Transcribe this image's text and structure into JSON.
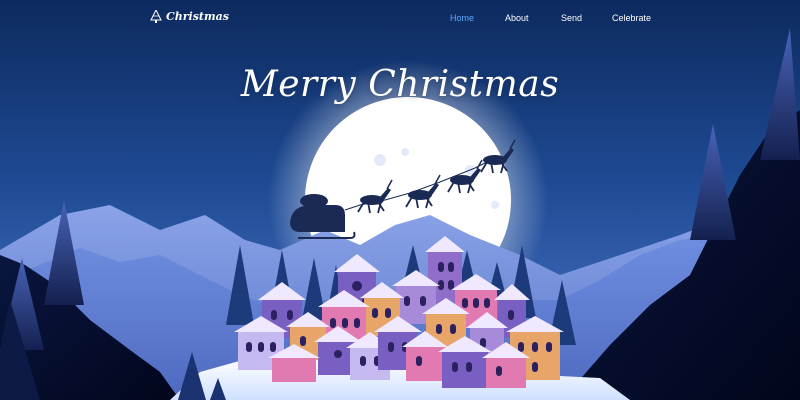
{
  "brand": {
    "name": "Christmas",
    "icon": "christmas-tree-icon"
  },
  "nav": {
    "items": [
      {
        "label": "Home",
        "active": true
      },
      {
        "label": "About",
        "active": false
      },
      {
        "label": "Send",
        "active": false
      },
      {
        "label": "Celebrate",
        "active": false
      }
    ]
  },
  "hero": {
    "title": "Merry Christmas"
  },
  "colors": {
    "sky_top": "#0d2a5e",
    "sky_bottom": "#5a84d6",
    "accent": "#5aa9ff",
    "moon": "#ffffff",
    "snow": "#f2f6ff"
  }
}
